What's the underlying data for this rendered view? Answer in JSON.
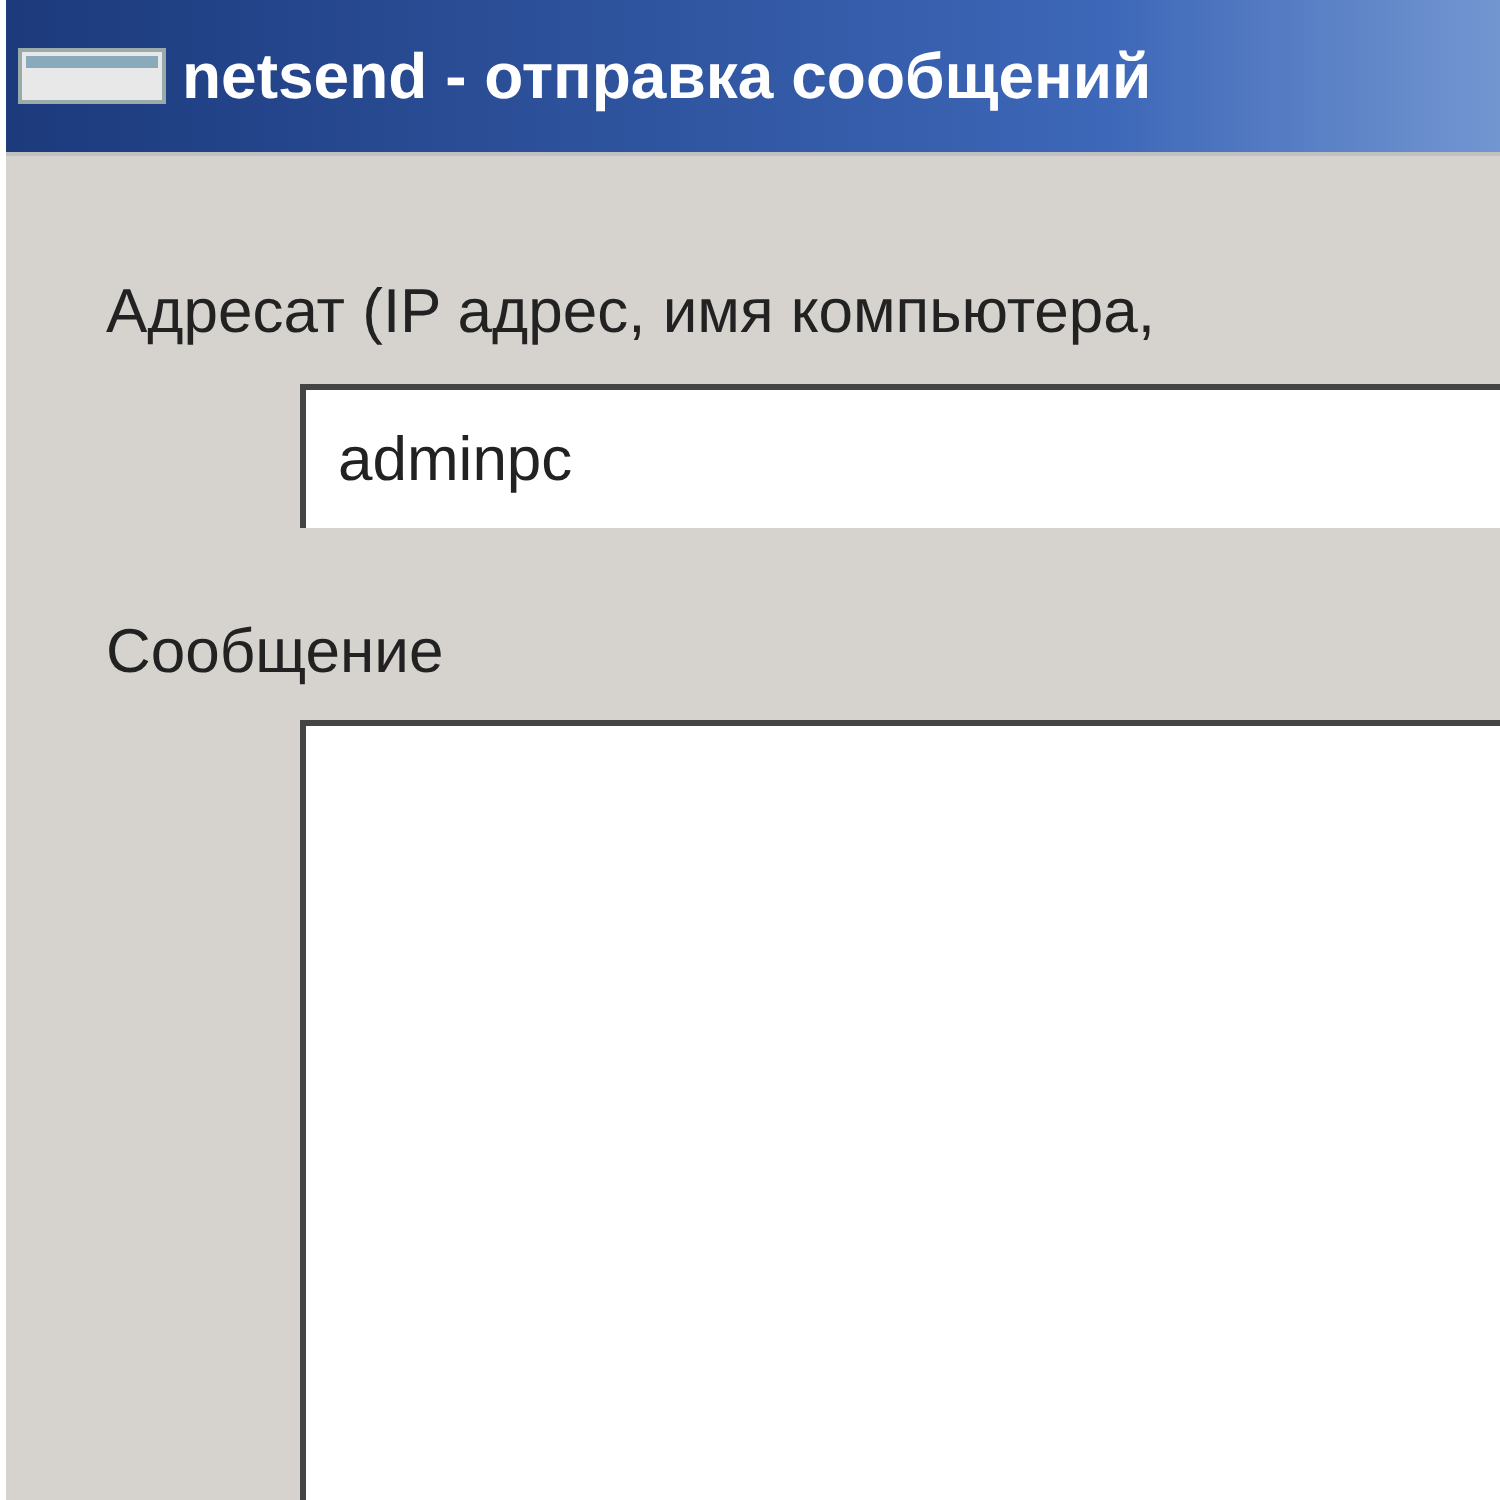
{
  "window": {
    "title": "netsend - отправка сообщений"
  },
  "recipient": {
    "label": "Адресат (IP адрес, имя компьютера,",
    "value": "adminpc"
  },
  "message": {
    "label": "Сообщение"
  }
}
